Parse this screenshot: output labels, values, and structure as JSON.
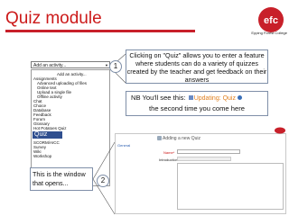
{
  "header": {
    "title": "Quiz module",
    "logo_text": "Epping Forest College",
    "logo_letters": "efc"
  },
  "dropdown": {
    "header_label": "Add an activity...",
    "items": [
      "Add an activity...",
      "Assignments",
      "Advanced uploading of files",
      "Online text",
      "Upload a single file",
      "Offline activity",
      "Chat",
      "Choice",
      "Database",
      "Feedback",
      "Forum",
      "Glossary",
      "Hot Potatoes Quiz",
      "Quiz",
      "SCORM/AICC",
      "Survey",
      "Wiki",
      "Workshop"
    ],
    "selected": "Quiz"
  },
  "callouts": {
    "one": {
      "number": "1",
      "text": "Clicking on \"Quiz\" allows you to enter a feature where students can do a variety of quizzes created by the teacher and get feedback on their answers"
    },
    "nb": {
      "prefix": "NB You'll see this:",
      "updating": "Updating: Quiz",
      "line2": "the second time you come here"
    },
    "two": {
      "number": "2",
      "text": "This is the window that opens..."
    }
  },
  "window": {
    "title": "Adding a new Quiz",
    "general": "General",
    "name_label": "Name*",
    "intro_label": "Introduction"
  },
  "colors": {
    "accent": "#c8202a",
    "selected_bg": "#2f4f8f",
    "updating": "#e08020"
  }
}
